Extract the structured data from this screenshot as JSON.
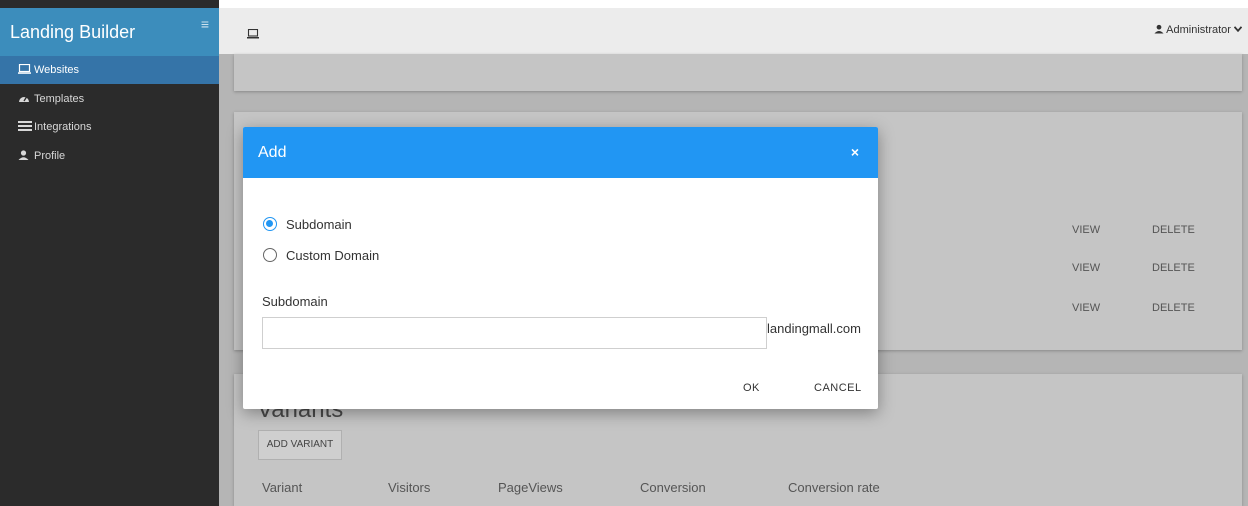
{
  "sidebar": {
    "brand": "Landing Builder",
    "menu_icon": "hamburger-icon",
    "items": [
      {
        "label": "Websites",
        "icon": "laptop-icon",
        "active": true
      },
      {
        "label": "Templates",
        "icon": "dashboard-icon",
        "active": false
      },
      {
        "label": "Integrations",
        "icon": "integrations-icon",
        "active": false
      },
      {
        "label": "Profile",
        "icon": "user-icon",
        "active": false
      }
    ]
  },
  "topbar": {
    "icon": "laptop-icon",
    "user": "Administrator",
    "user_icon": "user-icon",
    "caret_icon": "chevron-down-icon"
  },
  "background": {
    "rows": [
      {
        "view": "VIEW",
        "delete": "DELETE"
      },
      {
        "view": "VIEW",
        "delete": "DELETE"
      },
      {
        "view": "VIEW",
        "delete": "DELETE"
      }
    ],
    "variants_title": "Variants",
    "add_variant": "ADD VARIANT",
    "columns": [
      "Variant",
      "Visitors",
      "PageViews",
      "Conversion",
      "Conversion rate"
    ]
  },
  "modal": {
    "title": "Add",
    "close": "×",
    "options": [
      {
        "label": "Subdomain",
        "checked": true
      },
      {
        "label": "Custom Domain",
        "checked": false
      }
    ],
    "field_label": "Subdomain",
    "field_value": "",
    "field_placeholder": "",
    "suffix": "landingmall.com",
    "ok": "OK",
    "cancel": "CANCEL"
  },
  "colors": {
    "accent": "#2196f3",
    "sidebar_bg": "#2b2b2b",
    "sidebar_header": "#3c8dbc",
    "sidebar_active": "#3574a8"
  }
}
